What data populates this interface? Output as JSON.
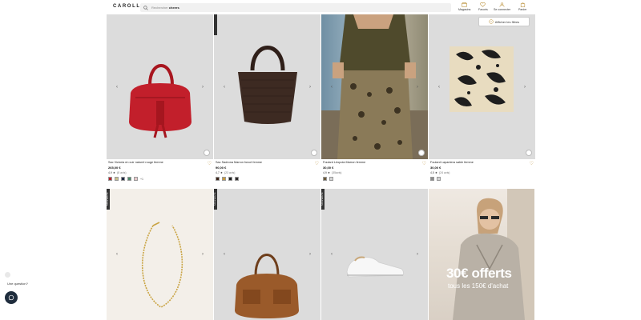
{
  "header": {
    "logo": "CAROLL",
    "search_prefix": "Rechercher ",
    "search_suffix": "cheers",
    "nav": [
      {
        "label": "Magasins",
        "icon": "store-icon"
      },
      {
        "label": "Favoris",
        "icon": "heart-icon"
      },
      {
        "label": "Se connecter",
        "icon": "user-icon"
      },
      {
        "label": "Panier",
        "icon": "bag-icon"
      }
    ]
  },
  "filters": {
    "label": "Afficher les filtres"
  },
  "products": [
    {
      "name": "Sac Victoria en cuir naturel rouge femme",
      "price": "265,00 €",
      "rating": "4,9",
      "reviews": "(8 avis)",
      "swatches": [
        "#b5202a",
        "#c9c08a",
        "#1f2a44",
        "#4c8a6b",
        "#e6c7c8"
      ],
      "more": "+1",
      "image_color": "#c21f2b"
    },
    {
      "name": "Sac Sadrona Marron foncé femme",
      "price": "90,00 €",
      "rating": "4,7",
      "reviews": "(23 avis)",
      "swatches": [
        "#3c2418",
        "#c99a3c",
        "#1e1e1e",
        "#2f2a2a"
      ],
      "image_color": "#3d2a22"
    },
    {
      "name": "Foulard Léopola Marron femme",
      "price": "30,00 €",
      "rating": "4,9",
      "reviews": "(35avis)",
      "swatches": [
        "#6b5a3a",
        "#d4d4d4"
      ],
      "image_color": "#8a7a58"
    },
    {
      "name": "Foulard Lapantera sable femme",
      "price": "30,00 €",
      "rating": "4,5",
      "reviews": "(24 avis)",
      "swatches": [
        "#8c8c8c",
        "#d4d4d4"
      ],
      "image_color": "#e5d8b6"
    },
    {
      "name": "",
      "tag": "NOUVEAUTÉ",
      "image_color": "#efe9e2"
    },
    {
      "name": "",
      "tag": "NOUVEAUTÉ",
      "image_color": "#9a5a2a"
    },
    {
      "name": "",
      "tag": "NOUVEAUTÉ",
      "image_color": "#f0f0f0"
    }
  ],
  "promo": {
    "headline": "30€ offerts",
    "subline": "tous les 150€ d'achat"
  },
  "chat": {
    "question": "Une question?"
  }
}
